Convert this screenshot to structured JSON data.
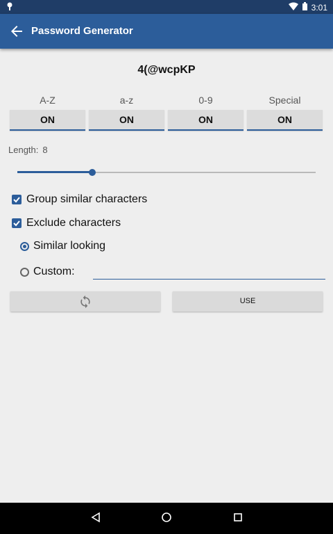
{
  "status_bar": {
    "time": "3:01"
  },
  "app_bar": {
    "title": "Password Generator"
  },
  "password": "4(@wcpKP",
  "char_sets": [
    {
      "label": "A-Z",
      "state": "ON"
    },
    {
      "label": "a-z",
      "state": "ON"
    },
    {
      "label": "0-9",
      "state": "ON"
    },
    {
      "label": "Special",
      "state": "ON"
    }
  ],
  "length": {
    "label": "Length:",
    "value": "8",
    "slider_fraction": 0.25
  },
  "options": {
    "group_similar": {
      "label": "Group similar characters",
      "checked": true
    },
    "exclude": {
      "label": "Exclude characters",
      "checked": true
    },
    "similar_looking": {
      "label": "Similar looking",
      "selected": true
    },
    "custom": {
      "label": "Custom:",
      "selected": false,
      "value": ""
    }
  },
  "buttons": {
    "use": "USE"
  },
  "colors": {
    "accent": "#2c5d9a",
    "statusbar": "#1f3d67",
    "background": "#eeeeee"
  }
}
